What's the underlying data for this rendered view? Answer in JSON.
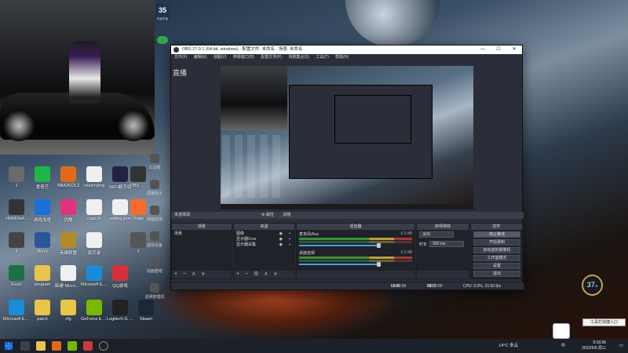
{
  "obs": {
    "title": "OBS 27.0.1 (64-bit, windows) - 配置文件: 未命名 - 场景: 未命名",
    "menu": [
      "文件(F)",
      "编辑(E)",
      "视图(V)",
      "停靠窗口(D)",
      "配置文件(P)",
      "场景集合(S)",
      "工具(T)",
      "帮助(H)"
    ],
    "win_controls": [
      "—",
      "☐",
      "✕"
    ],
    "left_title": "直播",
    "no_source": "未选择源",
    "scene_buttons": [
      "⚙ 属性",
      "滤镜"
    ],
    "docks": {
      "scenes": {
        "title": "场景",
        "items": [
          "场景"
        ],
        "footer": [
          "+",
          "−",
          "∧",
          "∨"
        ]
      },
      "sources": {
        "title": "来源",
        "items": [
          "图像",
          "显示器/Live",
          "显示器采集"
        ],
        "footer": [
          "+",
          "−",
          "⚙",
          "∧",
          "∨"
        ]
      },
      "mixer": {
        "title": "混音器",
        "channels": [
          {
            "name": "麦克风/Aux",
            "db": "0.0 dB"
          },
          {
            "name": "桌面音频",
            "db": "0.0 dB"
          }
        ]
      },
      "transitions": {
        "title": "转场特效",
        "type": "淡出",
        "duration_label": "时长",
        "duration_value": "300 ms"
      },
      "controls": {
        "title": "控件",
        "buttons": [
          "停止推流",
          "开始录制",
          "启动虚拟摄像机",
          "工作室模式",
          "设置",
          "退出"
        ]
      }
    },
    "status": {
      "live_label": "LIVE:",
      "live_time": "00:00:00",
      "rec_label": "REC:",
      "rec_time": "00:00:00",
      "cpu": "CPU: 0.0%, 10.00 fps"
    }
  },
  "desktop_icons": [
    {
      "label": "1",
      "color": "#6a6a6a"
    },
    {
      "label": "爱奇艺",
      "color": "#1fb54a"
    },
    {
      "label": "NBA2KOL2",
      "color": "#e06a18"
    },
    {
      "label": "relaxmdmp",
      "color": "#eeeeee"
    },
    {
      "label": "SEFI超手站",
      "color": "#222244"
    },
    {
      "label": "c99b63a4...",
      "color": "#333333"
    },
    {
      "label": "游戏加速",
      "color": "#1a6fd8"
    },
    {
      "label": "优酷",
      "color": "#e0347a"
    },
    {
      "label": "csgo.bt",
      "color": "#f0f0f0"
    },
    {
      "label": "setting.json",
      "color": "#f0f0f0"
    },
    {
      "label": "2",
      "color": "#444444"
    },
    {
      "label": "Word",
      "color": "#2b579a"
    },
    {
      "label": "英雄联盟",
      "color": "#b38a2a"
    },
    {
      "label": "恩克录",
      "color": "#f0f0f0"
    },
    {
      "label": "Excel",
      "color": "#1d7044"
    },
    {
      "label": "program",
      "color": "#e8c44a"
    },
    {
      "label": "新建 Microsoft...",
      "color": "#f0f0f0"
    },
    {
      "label": "Microsoft Edge",
      "color": "#1a8bd8"
    },
    {
      "label": "QQ游戏",
      "color": "#d8303a"
    },
    {
      "label": "Microsoft Edge",
      "color": "#1a8bd8"
    },
    {
      "label": "patch",
      "color": "#e8c44a"
    },
    {
      "label": "cfg",
      "color": "#e8c44a"
    },
    {
      "label": "GeForce Experience",
      "color": "#76b900"
    },
    {
      "label": "Logitech G HUB",
      "color": "#222222"
    },
    {
      "label": "Steam",
      "color": "#1b2838"
    }
  ],
  "extra_icons": [
    {
      "label": "OBS St...",
      "color": "#333333"
    },
    {
      "label": "Origin",
      "color": "#f56c2d"
    },
    {
      "label": "1",
      "color": "#555555"
    }
  ],
  "side_strip": [
    "工具箱",
    "屏幕助手",
    "电脑加速",
    "虚拟设备",
    "动画壁纸",
    "说明管理机"
  ],
  "taskbar": {
    "tray": "14°C 多云",
    "lang": "中",
    "clock_time": "9:18:36",
    "clock_date": "2022/5/6 周三",
    "tooltip": "工具栏快捷入口",
    "speed": "37",
    "speed_unit": "%"
  },
  "top_badge": {
    "num": "35",
    "sub": "行业平台"
  }
}
